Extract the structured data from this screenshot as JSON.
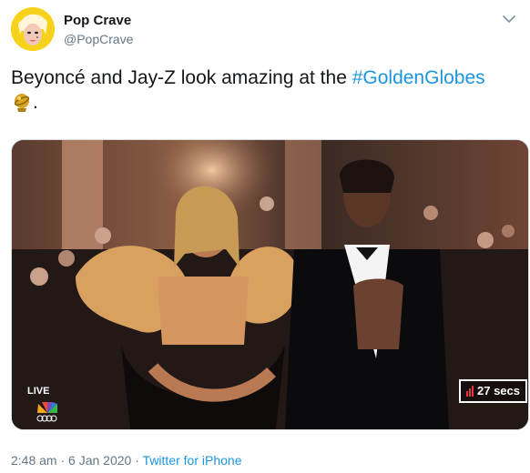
{
  "author": {
    "display_name": "Pop Crave",
    "handle": "@PopCrave",
    "avatar_icon": "avatar-portrait-icon"
  },
  "tweet": {
    "text_prefix": "Beyoncé and Jay-Z look amazing at the ",
    "hashtag": "#GoldenGlobes",
    "text_suffix": ".",
    "emoji_icon": "golden-globe-emoji-icon"
  },
  "media": {
    "network_label": "LIVE",
    "network_logo_icon": "nbc-peacock-icon",
    "timer": "27 secs",
    "timer_icon": "signal-bars-icon"
  },
  "meta": {
    "time": "2:48 am",
    "separator1": " · ",
    "date": "6 Jan 2020",
    "separator2": " · ",
    "source": "Twitter for iPhone"
  },
  "colors": {
    "link": "#1b95e0",
    "muted": "#657786",
    "text": "#14171a",
    "avatar_bg": "#f6d21b"
  }
}
